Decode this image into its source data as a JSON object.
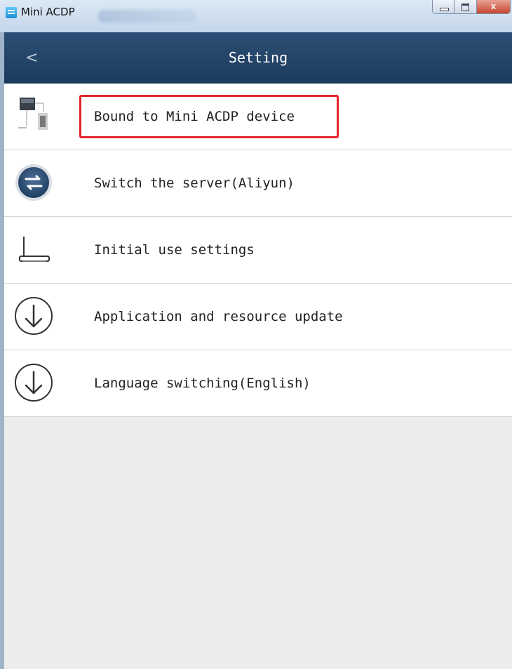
{
  "window": {
    "title": "Mini ACDP",
    "close_glyph": "x"
  },
  "header": {
    "back_glyph": "<",
    "title": "Setting"
  },
  "settings": {
    "items": [
      {
        "label": "Bound to Mini ACDP device",
        "icon": "device-bind-icon",
        "highlighted": true
      },
      {
        "label": "Switch the server(Aliyun)",
        "icon": "switch-server-icon",
        "highlighted": false
      },
      {
        "label": "Initial use settings",
        "icon": "router-icon",
        "highlighted": false
      },
      {
        "label": "Application and resource update",
        "icon": "download-icon",
        "highlighted": false
      },
      {
        "label": "Language switching(English)",
        "icon": "download-icon",
        "highlighted": false
      }
    ]
  },
  "colors": {
    "header_bg": "#1f3f63",
    "highlight_border": "#e4232b",
    "background": "#ececec"
  }
}
